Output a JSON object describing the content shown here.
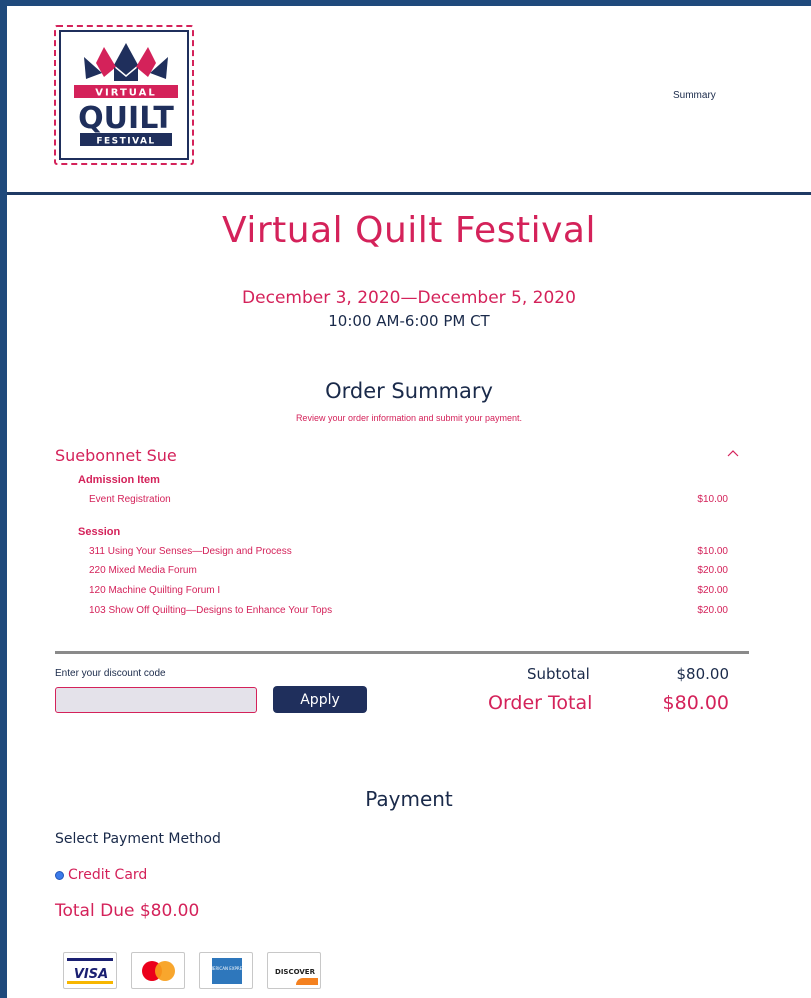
{
  "header": {
    "logo_text": {
      "line1": "VIRTUAL",
      "line2": "QUILT",
      "line3": "FESTIVAL"
    },
    "nav_summary": "Summary"
  },
  "event": {
    "title": "Virtual Quilt Festival",
    "dates": "December 3, 2020—December 5, 2020",
    "times": "10:00 AM-6:00 PM CT"
  },
  "order_summary": {
    "title": "Order Summary",
    "subtitle": "Review your order information and submit your payment.",
    "attendee": "Suebonnet Sue",
    "collapse_icon": "chevron-up-icon",
    "groups": [
      {
        "heading": "Admission Item",
        "items": [
          {
            "name": "Event Registration",
            "price": "$10.00"
          }
        ]
      },
      {
        "heading": "Session",
        "items": [
          {
            "name": "311 Using Your Senses—Design and Process",
            "price": "$10.00"
          },
          {
            "name": "220 Mixed Media Forum",
            "price": "$20.00"
          },
          {
            "name": "120 Machine Quilting Forum I",
            "price": "$20.00"
          },
          {
            "name": "103 Show Off Quilting—Designs to Enhance Your Tops",
            "price": "$20.00"
          }
        ]
      }
    ]
  },
  "discount": {
    "label": "Enter your discount code",
    "value": "",
    "apply_label": "Apply"
  },
  "totals": {
    "subtotal_label": "Subtotal",
    "subtotal_value": "$80.00",
    "order_total_label": "Order Total",
    "order_total_value": "$80.00"
  },
  "payment": {
    "title": "Payment",
    "method_label": "Select Payment Method",
    "selected_method": "Credit Card",
    "total_due": "Total Due $80.00",
    "cards": [
      {
        "name": "visa-card-icon",
        "text": "VISA"
      },
      {
        "name": "mastercard-card-icon",
        "text": ""
      },
      {
        "name": "amex-card-icon",
        "text": "AMERICAN EXPRESS"
      },
      {
        "name": "discover-card-icon",
        "text": "DISCOVER"
      }
    ]
  },
  "colors": {
    "accent": "#d4225a",
    "navy": "#1f2f5c",
    "frame": "#1f4a7c",
    "radio": "#3b7bea"
  }
}
